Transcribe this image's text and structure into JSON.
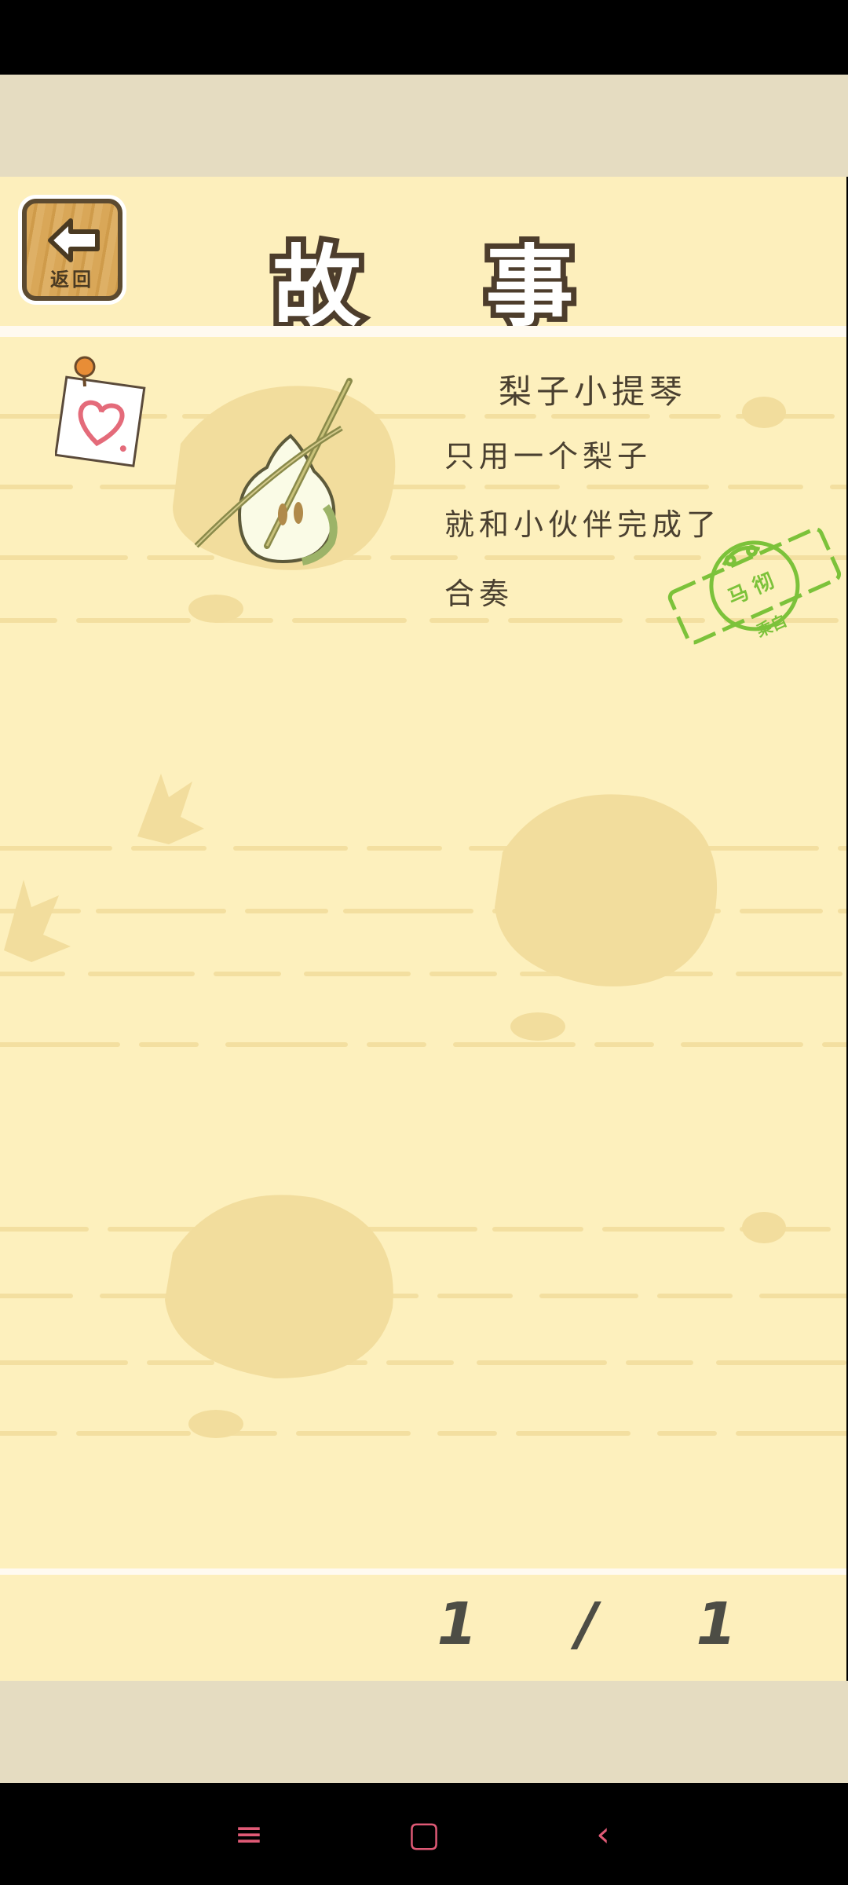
{
  "header": {
    "title": "故 事",
    "back_label": "返回"
  },
  "story": {
    "title": "梨子小提琴",
    "lines": [
      "只用一个梨子",
      "就和小伙伴完成了",
      "合奏"
    ],
    "stamp_name": "马 彻",
    "stamp_label": "乘自"
  },
  "pagination": {
    "text": "1 / 1"
  },
  "nav": {
    "menu_icon": "≡",
    "home_icon": "▢",
    "back_icon": "‹"
  },
  "colors": {
    "background": "#fdf0bd",
    "stamp": "#7cc23a",
    "title_outline": "#4d3d2c"
  }
}
